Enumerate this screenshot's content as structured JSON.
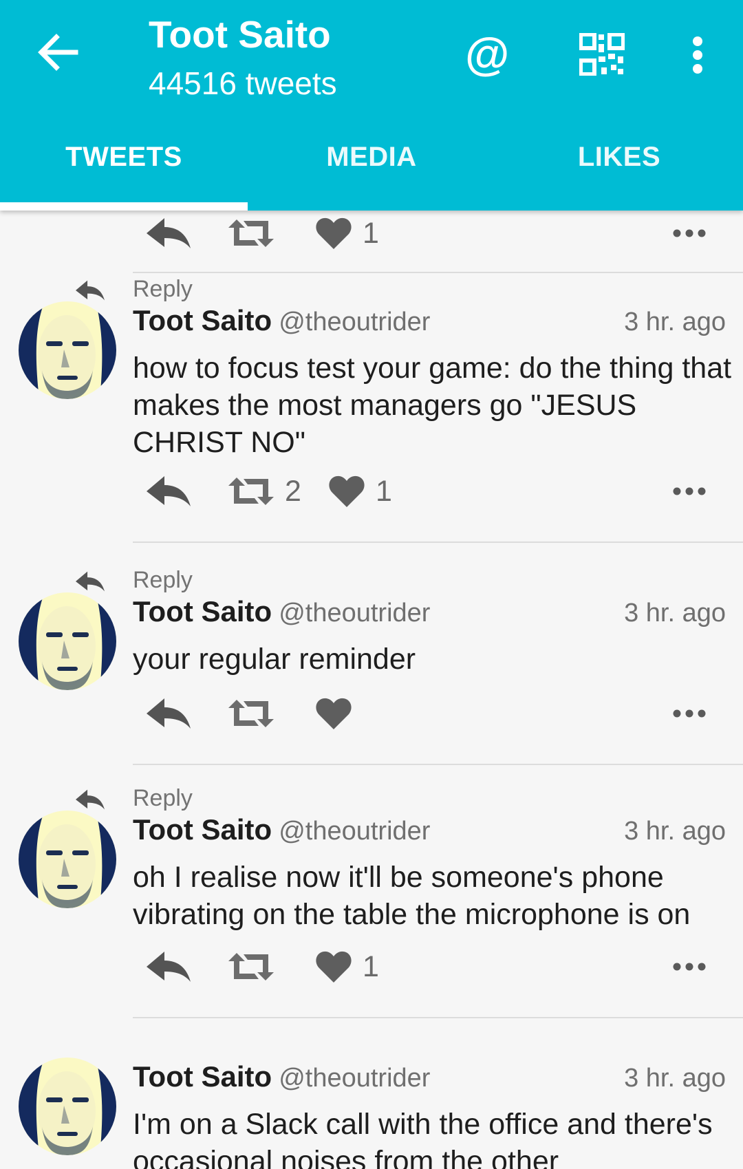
{
  "header": {
    "title": "Toot Saito",
    "subtitle": "44516 tweets",
    "mention_symbol": "@",
    "bg_color": "#00bcd4"
  },
  "tabs": [
    {
      "label": "TWEETS",
      "active": true
    },
    {
      "label": "MEDIA",
      "active": false
    },
    {
      "label": "LIKES",
      "active": false
    }
  ],
  "partial_actions": {
    "likes": "1"
  },
  "tweets": [
    {
      "context": "Reply",
      "name": "Toot Saito",
      "handle": "@theoutrider",
      "time": "3 hr. ago",
      "text": "how to focus test your game: do the thing that makes the most managers go \"JESUS CHRIST NO\"",
      "retweets": "2",
      "likes": "1"
    },
    {
      "context": "Reply",
      "name": "Toot Saito",
      "handle": "@theoutrider",
      "time": "3 hr. ago",
      "text": "your regular reminder",
      "retweets": "",
      "likes": ""
    },
    {
      "context": "Reply",
      "name": "Toot Saito",
      "handle": "@theoutrider",
      "time": "3 hr. ago",
      "text": "oh I realise now it'll be someone's phone vibrating on the table the microphone is on",
      "retweets": "",
      "likes": "1"
    },
    {
      "context": "",
      "name": "Toot Saito",
      "handle": "@theoutrider",
      "time": "3 hr. ago",
      "text": "I'm on a Slack call with the office and there's occasional noises from the other",
      "retweets": "",
      "likes": ""
    }
  ]
}
